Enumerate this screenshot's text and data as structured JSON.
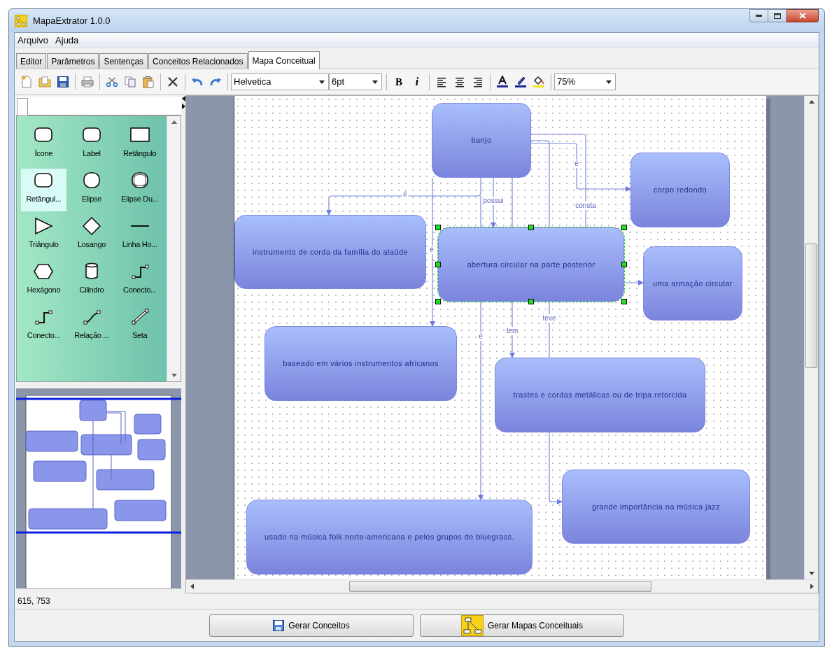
{
  "window": {
    "title": "MapaExtrator 1.0.0"
  },
  "menu": [
    "Arquivo",
    "Ajuda"
  ],
  "tabs": [
    {
      "label": "Editor",
      "selected": false
    },
    {
      "label": "Parâmetros",
      "selected": false
    },
    {
      "label": "Sentenças",
      "selected": false
    },
    {
      "label": "Conceitos Relacionados",
      "selected": false
    },
    {
      "label": "Mapa Conceitual",
      "selected": true
    }
  ],
  "toolbar": {
    "font": "Helvetica",
    "size": "6pt",
    "bold": "B",
    "italic": "i",
    "zoom": "75%"
  },
  "palette": {
    "items": [
      {
        "label": "Ícone",
        "kind": "rounded",
        "selected": false
      },
      {
        "label": "Label",
        "kind": "rounded",
        "selected": false
      },
      {
        "label": "Retângulo",
        "kind": "rect",
        "selected": false
      },
      {
        "label": "Retângul...",
        "kind": "rounded",
        "selected": true
      },
      {
        "label": "Elipse",
        "kind": "circle",
        "selected": false
      },
      {
        "label": "Elipse Du...",
        "kind": "double",
        "selected": false
      },
      {
        "label": "Triângulo",
        "kind": "triangle",
        "selected": false
      },
      {
        "label": "Losango",
        "kind": "diamond",
        "selected": false
      },
      {
        "label": "Linha Ho...",
        "kind": "line",
        "selected": false
      },
      {
        "label": "Hexágono",
        "kind": "hexagon",
        "selected": false
      },
      {
        "label": "Cilindro",
        "kind": "cylinder",
        "selected": false
      },
      {
        "label": "Conecto...",
        "kind": "connector",
        "selected": false
      },
      {
        "label": "Conecto...",
        "kind": "connector",
        "selected": false
      },
      {
        "label": "Relação ...",
        "kind": "relation",
        "selected": false
      },
      {
        "label": "Seta",
        "kind": "arrow",
        "selected": false
      }
    ]
  },
  "map": {
    "nodes": [
      {
        "text": "banjo",
        "selected": false
      },
      {
        "text": "corpo redondo",
        "selected": false
      },
      {
        "text": "instrumento de corda da família do alaúde",
        "selected": false
      },
      {
        "text": "abertura circular na parte posterior",
        "selected": true
      },
      {
        "text": "uma armação circular",
        "selected": false
      },
      {
        "text": "baseado em vários instrumentos africanos",
        "selected": false
      },
      {
        "text": "trastes e cordas metálicas ou de tripa retorcida",
        "selected": false
      },
      {
        "text": "grande importância na música jazz",
        "selected": false
      },
      {
        "text": "usado na música folk norte-americana e pelos grupos de bluegrass.",
        "selected": false
      }
    ],
    "edges": [
      {
        "label": "é"
      },
      {
        "label": "possui"
      },
      {
        "label": "é"
      },
      {
        "label": "é"
      },
      {
        "label": "é"
      },
      {
        "label": "consta"
      },
      {
        "label": "tem"
      },
      {
        "label": "teve"
      }
    ]
  },
  "status": "615, 753",
  "buttons": [
    {
      "label": "Gerar Conceitos",
      "kind": "save"
    },
    {
      "label": "Gerar Mapas Conceituais",
      "kind": "map"
    }
  ]
}
